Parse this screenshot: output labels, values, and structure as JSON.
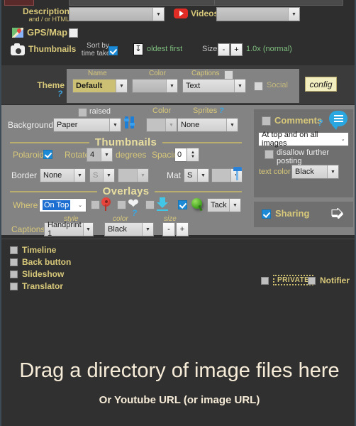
{
  "topbar": {
    "description_label": "Description",
    "description_sub": "and / or HTML",
    "description_value": "",
    "videos_label": "Videos",
    "videos_value": "",
    "videos_icon": "youtube-icon",
    "gps_label": "GPS/Map",
    "gps_icon": "google-maps-icon",
    "thumbnails_label": "Thumbnails",
    "thumbnails_icon": "camera-icon",
    "sort_by_line1": "Sort by",
    "sort_by_line2": "time taken",
    "sort_order_label": "oldest first",
    "sort_order_icon": "sort-down-icon",
    "size_label": "Size",
    "size_minus": "-",
    "size_plus": "+",
    "size_value": "1.0x (normal)"
  },
  "theme": {
    "label": "Theme",
    "help": "?",
    "name_label": "Name",
    "name_value": "Default",
    "color_label": "Color",
    "color_value": "",
    "captions_label": "Captions",
    "captions_value": "Text",
    "social_label": "Social",
    "config_label": "config"
  },
  "background": {
    "raised_label": "raised",
    "label": "Background",
    "value": "Paper",
    "sliders_icon": "sliders-icon",
    "color_label": "Color",
    "sprites_label": "Sprites",
    "sprites_help": "?",
    "sprites_value": "None"
  },
  "thumbnails_section": {
    "title": "Thumbnails",
    "polaroid_label": "Polaroid",
    "rotate_label": "Rotate",
    "rotate_value": "4",
    "degrees_label": "degrees",
    "spacing_label": "Spacing",
    "spacing_value": "0",
    "border_label": "Border",
    "border_value": "None",
    "border_size_value": "S",
    "mat_label": "Mat",
    "mat_size_value": "S",
    "mat_pin_icon": "blue-pin-icon"
  },
  "overlays": {
    "title": "Overlays",
    "where_label": "Where",
    "where_value": "On Top",
    "pin_icon": "map-pin-icon",
    "heart_icon": "heart-icon",
    "download_icon": "download-arrow-icon",
    "greenpin_icon": "green-push-pin-icon",
    "help": "?",
    "tack_value": "Tack",
    "captions_label": "Captions",
    "style_label": "style",
    "style_value": "Handprint 1",
    "color_label": "color",
    "color_value": "Black",
    "size_label": "size",
    "size_minus": "-",
    "size_plus": "+"
  },
  "comments": {
    "label": "Comments",
    "help": "?",
    "bubble_icon": "comment-bubble-icon",
    "position_value": "At top and on all images",
    "disallow_label": "disallow further posting",
    "text_color_label": "text color",
    "text_color_value": "Black"
  },
  "sharing": {
    "label": "Sharing",
    "icon": "share-arrow-icon"
  },
  "options": {
    "items": [
      {
        "label": "Timeline",
        "checked": false
      },
      {
        "label": "Back button",
        "checked": false
      },
      {
        "label": "Slideshow",
        "checked": false
      },
      {
        "label": "Translator",
        "checked": false
      }
    ],
    "private_label": "PRIVATE",
    "notifier_label": "Notifier"
  },
  "dropzone": {
    "headline": "Drag a directory of image files here",
    "subline": "Or Youtube URL (or image URL)"
  },
  "colors": {
    "accent_gold": "#d8c87a",
    "panel_grey": "#838383",
    "panel_dark": "#4b4b4b",
    "background_dark": "#2e2e2e",
    "checkbox_blue": "#1c8ad6",
    "help_blue": "#3ca5e0",
    "config_bg": "#f3eec0",
    "theme_name_bg": "#cbc073"
  }
}
